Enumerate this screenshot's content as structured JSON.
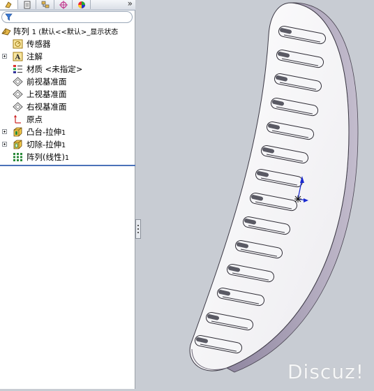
{
  "feature_tree": {
    "root": {
      "name": "阵列",
      "suffix": "1 (默认<<默认>_显示状态",
      "icon": "part-icon"
    },
    "items": [
      {
        "label": "传感器",
        "icon": "sensor-icon",
        "expandable": false
      },
      {
        "label": "注解",
        "icon": "annotation-icon",
        "expandable": true
      },
      {
        "label": "材质 <未指定>",
        "icon": "material-icon",
        "expandable": false
      },
      {
        "label": "前视基准面",
        "icon": "plane-icon",
        "expandable": false
      },
      {
        "label": "上视基准面",
        "icon": "plane-icon",
        "expandable": false
      },
      {
        "label": "右视基准面",
        "icon": "plane-icon",
        "expandable": false
      },
      {
        "label": "原点",
        "icon": "origin-icon",
        "expandable": false
      },
      {
        "label": "凸台-拉伸",
        "num": "1",
        "icon": "extrude-boss-icon",
        "expandable": true
      },
      {
        "label": "切除-拉伸",
        "num": "1",
        "icon": "extrude-cut-icon",
        "expandable": true
      },
      {
        "label": "阵列(线性)",
        "num": "1",
        "icon": "linear-pattern-icon",
        "expandable": false
      }
    ]
  },
  "tabs": [
    {
      "icon": "feature-manager-icon"
    },
    {
      "icon": "property-manager-icon"
    },
    {
      "icon": "configuration-manager-icon"
    },
    {
      "icon": "dimxpert-icon"
    },
    {
      "icon": "display-manager-icon"
    }
  ],
  "more_tabs": "»",
  "watermark": "Discuz!",
  "colors": {
    "viewport_bg": "#c8ccd3",
    "part_face": "#f3f3f5",
    "part_side": "#a89fb4",
    "slot_dark": "#5a5a64"
  }
}
